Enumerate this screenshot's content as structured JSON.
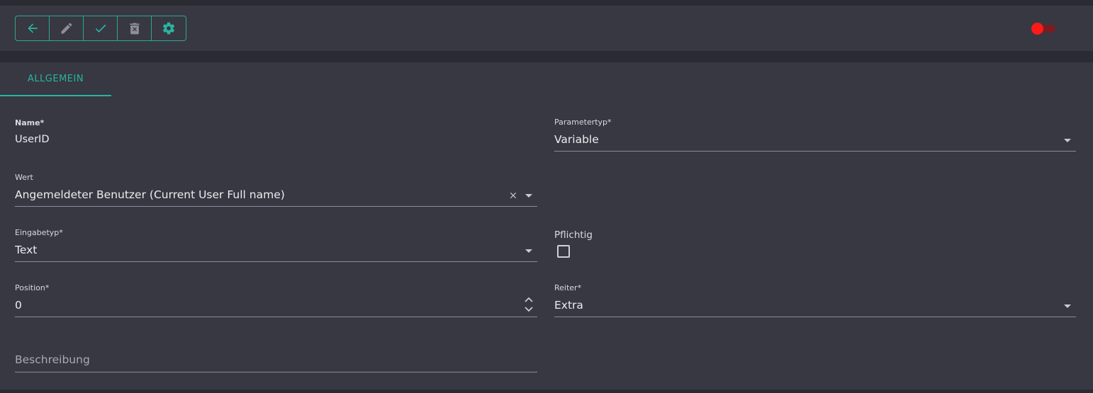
{
  "toolbar": {
    "buttons": [
      {
        "name": "back",
        "icon": "arrow-left-icon"
      },
      {
        "name": "edit",
        "icon": "pencil-icon"
      },
      {
        "name": "save",
        "icon": "check-icon"
      },
      {
        "name": "delete",
        "icon": "trash-icon"
      },
      {
        "name": "settings",
        "icon": "gear-icon"
      }
    ],
    "toggle": {
      "state": "off",
      "color": "#ff1a1a"
    }
  },
  "tabs": [
    {
      "label": "ALLGEMEIN",
      "active": true
    }
  ],
  "form": {
    "name": {
      "label": "Name*",
      "value": "UserID"
    },
    "parametertyp": {
      "label": "Parametertyp*",
      "value": "Variable"
    },
    "wert": {
      "label": "Wert",
      "value": "Angemeldeter Benutzer (Current User Full name)"
    },
    "eingabetyp": {
      "label": "Eingabetyp*",
      "value": "Text"
    },
    "pflichtig": {
      "label": "Pflichtig",
      "checked": false
    },
    "position": {
      "label": "Position*",
      "value": "0"
    },
    "reiter": {
      "label": "Reiter*",
      "value": "Extra"
    },
    "beschreibung": {
      "placeholder": "Beschreibung"
    }
  },
  "colors": {
    "accent": "#2bb3a3",
    "background": "#2b2c33",
    "panel": "#373841"
  }
}
